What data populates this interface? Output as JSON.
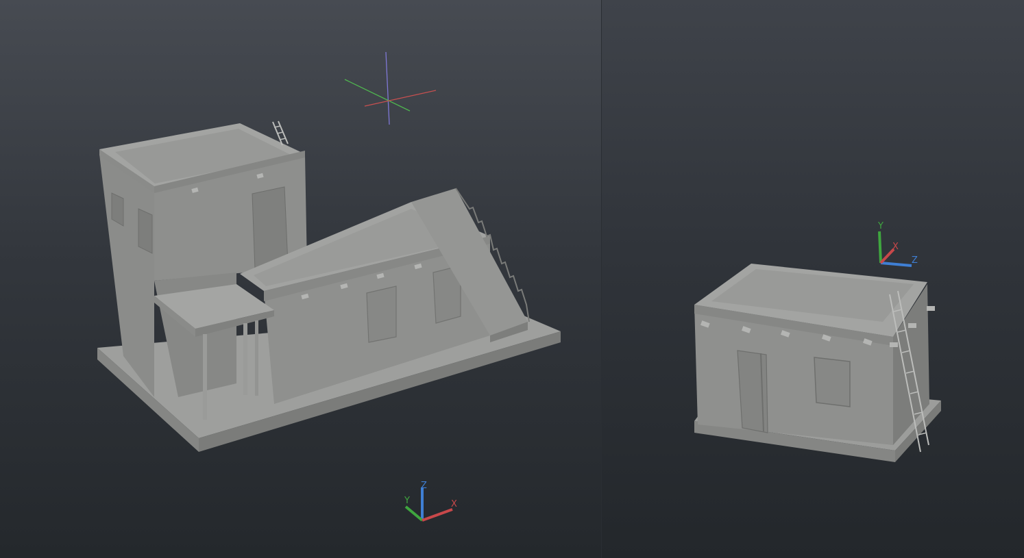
{
  "viewports": {
    "left": {
      "ucs_icon": {
        "x_label": "X",
        "y_label": "Y",
        "z_label": "Z"
      }
    },
    "right": {
      "ucs_icon": {
        "x_label": "X",
        "y_label": "Y",
        "z_label": "Z"
      }
    }
  },
  "colors": {
    "axis_x": "#c8484a",
    "axis_y": "#3fa63f",
    "axis_z": "#3f7fd4",
    "model_face_light": "#9c9d9b",
    "model_face_mid": "#8a8b89",
    "model_face_dark": "#7a7b79"
  }
}
